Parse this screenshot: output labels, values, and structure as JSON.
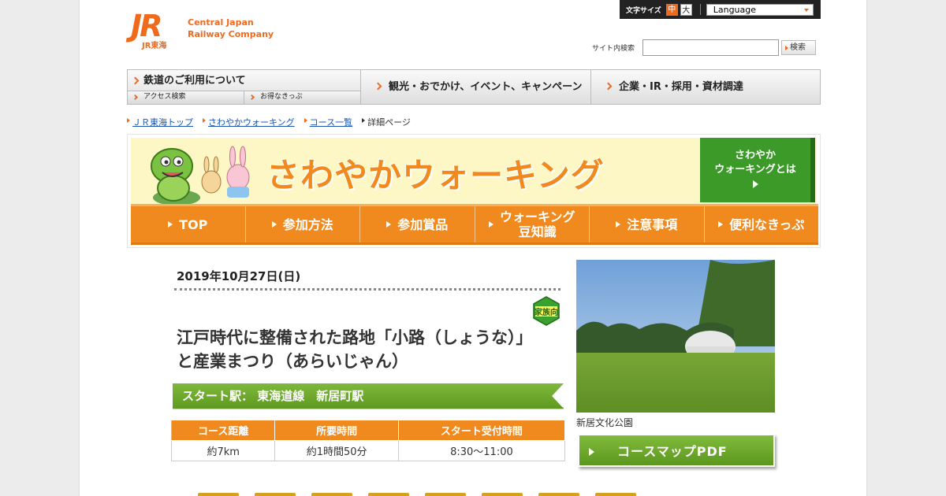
{
  "header": {
    "logo_mark": "JR",
    "logo_sub": "JR東海",
    "company_line1": "Central Japan",
    "company_line2": "Railway Company",
    "font_size_label": "文字サイズ",
    "font_mid": "中",
    "font_big": "大",
    "language": "Language",
    "search_label": "サイト内検索",
    "search_value": "",
    "search_button": "検索"
  },
  "gnav": {
    "railway": "鉄道のご利用について",
    "access": "アクセス検索",
    "tickets": "お得なきっぷ",
    "tourism": "観光・おでかけ、イベント、キャンペーン",
    "corporate": "企業・IR・採用・資材調達"
  },
  "breadcrumb": [
    "ＪＲ東海トップ",
    "さわやかウォーキング",
    "コース一覧",
    "詳細ページ"
  ],
  "banner": {
    "title": "さわやかウォーキング",
    "what_line1": "さわやか",
    "what_line2": "ウォーキングとは",
    "nav": [
      {
        "line1": "TOP",
        "line2": ""
      },
      {
        "line1": "参加方法",
        "line2": ""
      },
      {
        "line1": "参加賞品",
        "line2": ""
      },
      {
        "line1": "ウォーキング",
        "line2": "豆知識"
      },
      {
        "line1": "注意事項",
        "line2": ""
      },
      {
        "line1": "便利なきっぷ",
        "line2": ""
      }
    ]
  },
  "course": {
    "date": "2019年10月27日(日)",
    "badge": "家族向",
    "title": "江戸時代に整備された路地「小路（しょうな）」と産業まつり（あらいじゃん）",
    "start": "スタート駅：  東海道線　新居町駅",
    "table_headers": [
      "コース距離",
      "所要時間",
      "スタート受付時間"
    ],
    "table_values": [
      "約7km",
      "約1時間50分",
      "8:30～11:00"
    ],
    "photo_caption": "新居文化公園",
    "pdf_button": "コースマップPDF"
  },
  "colors": {
    "brand_orange": "#f06a1e",
    "nav_orange": "#f08a1e",
    "green": "#5e9a22"
  }
}
